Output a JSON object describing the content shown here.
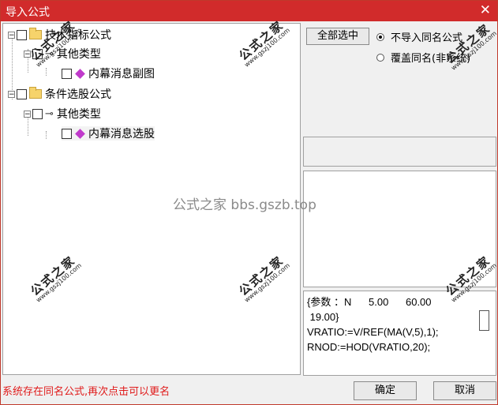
{
  "window": {
    "title": "导入公式",
    "close_glyph": "✕"
  },
  "tree": [
    {
      "label": "技术指标公式"
    },
    {
      "label": "其他类型"
    },
    {
      "label": "内幕消息副图"
    },
    {
      "label": "条件选股公式"
    },
    {
      "label": "其他类型"
    },
    {
      "label": "内幕消息选股"
    }
  ],
  "buttons": {
    "select_all": "全部选中",
    "ok": "确定",
    "cancel": "取消"
  },
  "options": {
    "skip_same_name": "不导入同名公式",
    "overwrite_same_name": "覆盖同名(非系统)",
    "selected": "skip_same_name"
  },
  "formula_lines": [
    "{参数 ：N      5.00      60.00",
    " 19.00}",
    "VRATIO:=V/REF(MA(V,5),1);",
    "RNOD:=HOD(VRATIO,20);"
  ],
  "status_message": "系统存在同名公式,再次点击可以更名",
  "watermark": {
    "title": "公式之家",
    "url": "www.gszj100.com",
    "center": "公式之家 bbs.gszb.top"
  },
  "icons": {
    "expander_collapse": "−",
    "key": "⊸"
  }
}
